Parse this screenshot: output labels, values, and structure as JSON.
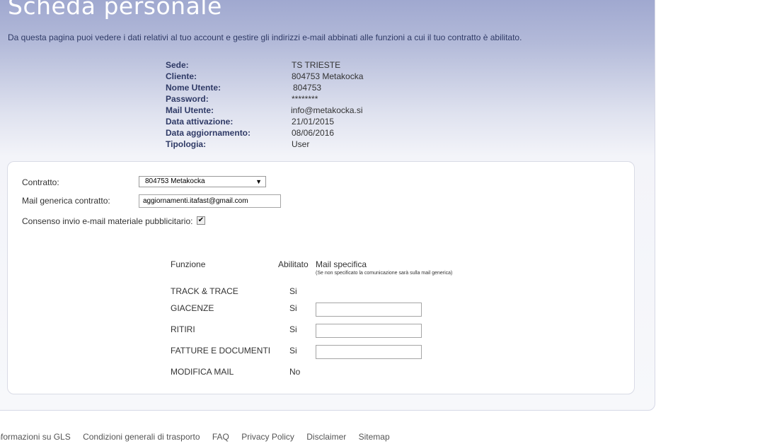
{
  "header": {
    "title": "Scheda personale",
    "intro": "Da questa pagina puoi vedere i dati relativi al tuo account e gestire gli indirizzi e-mail abbinati alle funzioni a cui il tuo contratto è abilitato."
  },
  "account": [
    {
      "label": "Sede:",
      "value": "TS TRIESTE"
    },
    {
      "label": "Cliente:",
      "value": "804753 Metakocka"
    },
    {
      "label": "Nome Utente:",
      "value": "804753"
    },
    {
      "label": "Password:",
      "value": "********"
    },
    {
      "label": "Mail Utente:",
      "value": "info@metakocka.si"
    },
    {
      "label": "Data attivazione:",
      "value": "21/01/2015"
    },
    {
      "label": "Data aggiornamento:",
      "value": "08/06/2016"
    },
    {
      "label": "Tipologia:",
      "value": "User"
    }
  ],
  "form": {
    "contratto_label": "Contratto:",
    "contratto_value": "804753 Metakocka",
    "mail_generica_label": "Mail generica contratto:",
    "mail_generica_value": "aggiornamenti.itafast@gmail.com",
    "consenso_label": "Consenso invio e-mail materiale pubblicitario:",
    "consenso_checked": true,
    "checkmark": "✔"
  },
  "functions": {
    "headers": {
      "funzione": "Funzione",
      "abilitato": "Abilitato",
      "mail": "Mail specifica",
      "note": "(Se non specificato la comunicazione sarà sulla mail generica)"
    },
    "rows": [
      {
        "name": "TRACK & TRACE",
        "enabled": "Si",
        "mail": ""
      },
      {
        "name": "GIACENZE",
        "enabled": "Si",
        "mail": ""
      },
      {
        "name": "RITIRI",
        "enabled": "Si",
        "mail": ""
      },
      {
        "name": "FATTURE E DOCUMENTI",
        "enabled": "Si",
        "mail": ""
      },
      {
        "name": "MODIFICA MAIL",
        "enabled": "No",
        "mail": ""
      }
    ]
  },
  "footer": {
    "links": [
      "Informazioni su GLS",
      "Condizioni generali di trasporto",
      "FAQ",
      "Privacy Policy",
      "Disclaimer",
      "Sitemap"
    ]
  },
  "colors": {
    "title": "#ffffff",
    "header_gradient_top": "#9aa3cd",
    "label_text": "#2f3a66"
  },
  "icons": {
    "dropdown": "chevron-down-icon",
    "check": "check-icon"
  }
}
